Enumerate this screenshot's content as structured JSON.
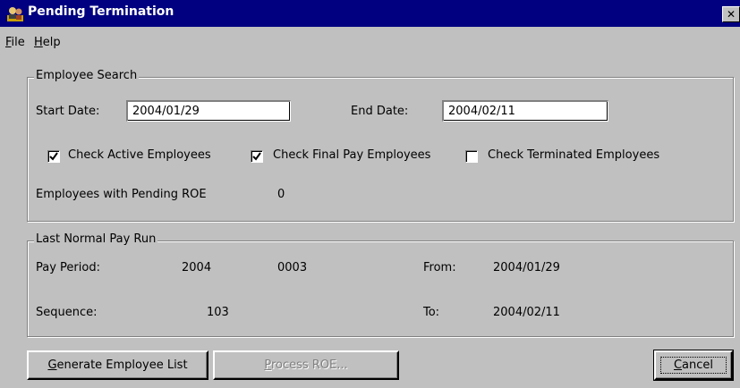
{
  "window": {
    "title": "Pending Termination",
    "close_glyph": "✕"
  },
  "menu": [
    {
      "mnemonic": "F",
      "rest": "ile"
    },
    {
      "mnemonic": "H",
      "rest": "elp"
    }
  ],
  "employee_search": {
    "group_label": "Employee Search",
    "start_date_label": "Start Date:",
    "start_date_value": "2004/01/29",
    "end_date_label": "End Date:",
    "end_date_value": "2004/02/11",
    "checks": [
      {
        "label": "Check Active Employees",
        "checked": true
      },
      {
        "label": "Check Final Pay Employees",
        "checked": true
      },
      {
        "label": "Check Terminated Employees",
        "checked": false
      }
    ],
    "pending_roe_label": "Employees with Pending ROE",
    "pending_roe_value": "0"
  },
  "last_pay_run": {
    "group_label": "Last Normal Pay Run",
    "pay_period_label": "Pay Period:",
    "pay_period_year": "2004",
    "pay_period_number": "0003",
    "from_label": "From:",
    "from_value": "2004/01/29",
    "sequence_label": "Sequence:",
    "sequence_value": "103",
    "to_label": "To:",
    "to_value": "2004/02/11"
  },
  "buttons": {
    "generate": {
      "mnemonic": "G",
      "rest": "enerate Employee List"
    },
    "process": {
      "mnemonic": "P",
      "rest": "rocess ROE..."
    },
    "cancel": {
      "mnemonic": "C",
      "rest": "ancel"
    }
  },
  "icons": {
    "app": "app-icon",
    "checkmark": "checkmark-icon"
  }
}
